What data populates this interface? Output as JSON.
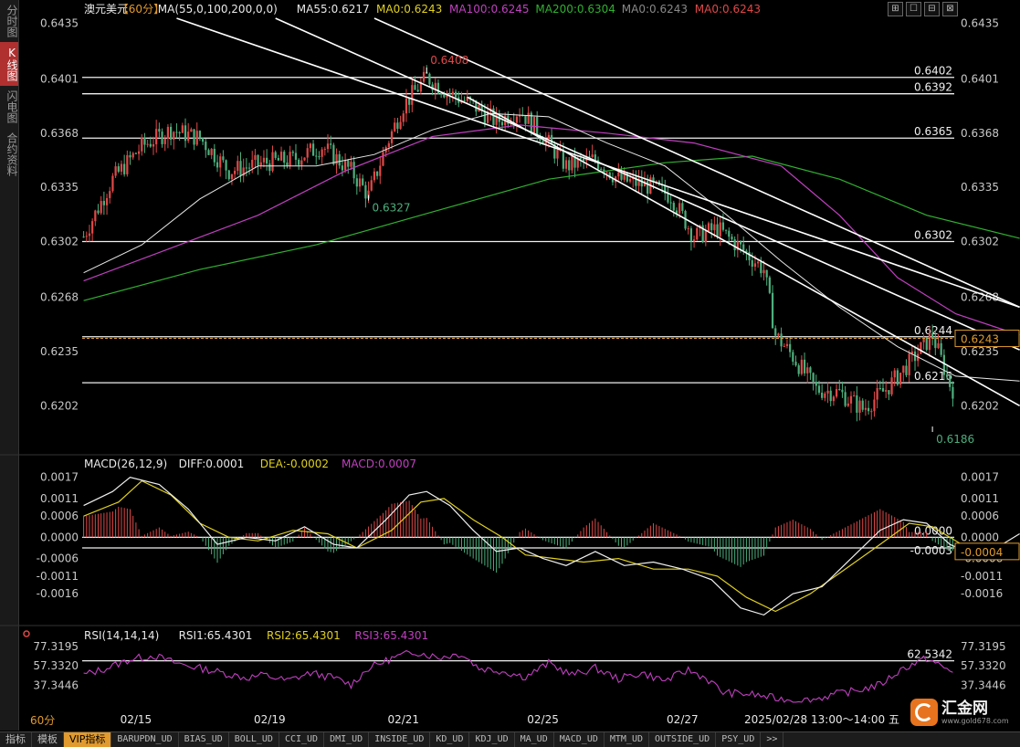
{
  "window_controls": [
    "⊞",
    "☐",
    "⊟",
    "⊠"
  ],
  "side_tabs": [
    {
      "label": "分时图",
      "active": false
    },
    {
      "label": "K线图",
      "active": true
    },
    {
      "label": "闪电图",
      "active": false
    },
    {
      "label": "合约资料",
      "active": false
    }
  ],
  "period_label": "60分",
  "logo": {
    "text": "汇金网",
    "url": "www.gold678.com"
  },
  "bottom_tabs": [
    {
      "label": "指标",
      "active": false,
      "big": true
    },
    {
      "label": "模板",
      "active": false,
      "big": true
    },
    {
      "label": "VIP指标",
      "active": true,
      "big": true
    },
    {
      "label": "BARUPDN_UD",
      "active": false
    },
    {
      "label": "BIAS_UD",
      "active": false
    },
    {
      "label": "BOLL_UD",
      "active": false
    },
    {
      "label": "CCI_UD",
      "active": false
    },
    {
      "label": "DMI_UD",
      "active": false
    },
    {
      "label": "INSIDE_UD",
      "active": false
    },
    {
      "label": "KD_UD",
      "active": false
    },
    {
      "label": "KDJ_UD",
      "active": false
    },
    {
      "label": "MA_UD",
      "active": false
    },
    {
      "label": "MACD_UD",
      "active": false
    },
    {
      "label": "MTM_UD",
      "active": false
    },
    {
      "label": "OUTSIDE_UD",
      "active": false
    },
    {
      "label": "PSY_UD",
      "active": false
    },
    {
      "label": ">>",
      "active": false
    }
  ],
  "colors": {
    "bg": "#000000",
    "up": "#e04848",
    "down": "#4caf7d",
    "ma_white": "#e8e8e8",
    "ma_magenta": "#c040c0",
    "ma_green": "#30b030",
    "yellow": "#e0d020",
    "grid_text": "#c8c8c8",
    "orange": "#e09a2d"
  },
  "chart_data": [
    {
      "type": "candlestick",
      "title_parts": [
        {
          "text": "澳元美元",
          "color": "#e8e8e8"
        },
        {
          "text": "【60分】",
          "color": "#e09a2d"
        },
        {
          "text": "MA(55,0,100,200,0,0)",
          "color": "#e8e8e8"
        },
        {
          "text": "MA55:0.6217",
          "color": "#e8e8e8"
        },
        {
          "text": "MA0:0.6243",
          "color": "#e0d020"
        },
        {
          "text": "MA100:0.6245",
          "color": "#c040c0"
        },
        {
          "text": "MA200:0.6304",
          "color": "#30b030"
        },
        {
          "text": "MA0:0.6243",
          "color": "#888888"
        },
        {
          "text": "MA0:0.6243",
          "color": "#e04848"
        }
      ],
      "ylim": [
        0.6171,
        0.6438
      ],
      "yticks": [
        "0.6435",
        "0.6401",
        "0.6368",
        "0.6335",
        "0.6302",
        "0.6268",
        "0.6235",
        "0.6202"
      ],
      "xticks": [
        {
          "label": "02/15",
          "index": 18
        },
        {
          "label": "02/19",
          "index": 64
        },
        {
          "label": "02/21",
          "index": 110
        },
        {
          "label": "02/25",
          "index": 158
        },
        {
          "label": "02/27",
          "index": 206
        }
      ],
      "time_label": "2025/02/28 13:00～14:00 五",
      "current_price": "0.6243",
      "horizontal_levels": [
        {
          "value": 0.6402,
          "label": "0.6402"
        },
        {
          "value": 0.6392,
          "label": "0.6392"
        },
        {
          "value": 0.6365,
          "label": "0.6365"
        },
        {
          "value": 0.6302,
          "label": "0.6302"
        },
        {
          "value": 0.6244,
          "label": "0.6244"
        },
        {
          "value": 0.6216,
          "label": "0.6216"
        }
      ],
      "annotations": [
        {
          "text": "0.6408",
          "index": 118,
          "value": 0.6408,
          "color": "#e04848"
        },
        {
          "text": "0.6327",
          "index": 98,
          "value": 0.6327,
          "color": "#4caf7d"
        },
        {
          "text": "0.6186",
          "index": 292,
          "value": 0.6186,
          "color": "#4caf7d"
        }
      ],
      "n_bars": 300,
      "anchors": [
        [
          0,
          0.6305
        ],
        [
          10,
          0.634
        ],
        [
          20,
          0.636
        ],
        [
          30,
          0.637
        ],
        [
          40,
          0.6365
        ],
        [
          50,
          0.6345
        ],
        [
          62,
          0.635
        ],
        [
          72,
          0.6352
        ],
        [
          82,
          0.636
        ],
        [
          92,
          0.6345
        ],
        [
          98,
          0.633
        ],
        [
          104,
          0.636
        ],
        [
          110,
          0.6385
        ],
        [
          118,
          0.6402
        ],
        [
          126,
          0.6392
        ],
        [
          134,
          0.6385
        ],
        [
          142,
          0.6375
        ],
        [
          150,
          0.6382
        ],
        [
          158,
          0.6366
        ],
        [
          166,
          0.6348
        ],
        [
          176,
          0.6352
        ],
        [
          184,
          0.634
        ],
        [
          194,
          0.6336
        ],
        [
          202,
          0.633
        ],
        [
          210,
          0.6305
        ],
        [
          218,
          0.631
        ],
        [
          226,
          0.6298
        ],
        [
          234,
          0.6285
        ],
        [
          238,
          0.6245
        ],
        [
          244,
          0.6232
        ],
        [
          252,
          0.6212
        ],
        [
          260,
          0.621
        ],
        [
          268,
          0.62
        ],
        [
          276,
          0.6212
        ],
        [
          284,
          0.6228
        ],
        [
          292,
          0.6245
        ],
        [
          298,
          0.6215
        ],
        [
          304,
          0.6198
        ],
        [
          310,
          0.6188
        ],
        [
          318,
          0.621
        ],
        [
          322,
          0.6243
        ]
      ],
      "ma_white": [
        [
          0,
          0.6283
        ],
        [
          20,
          0.63
        ],
        [
          40,
          0.6328
        ],
        [
          60,
          0.6348
        ],
        [
          80,
          0.6348
        ],
        [
          100,
          0.6355
        ],
        [
          120,
          0.637
        ],
        [
          140,
          0.638
        ],
        [
          160,
          0.6378
        ],
        [
          180,
          0.6362
        ],
        [
          200,
          0.6348
        ],
        [
          220,
          0.632
        ],
        [
          240,
          0.629
        ],
        [
          260,
          0.6262
        ],
        [
          280,
          0.6238
        ],
        [
          300,
          0.622
        ],
        [
          322,
          0.6217
        ]
      ],
      "ma_magenta": [
        [
          0,
          0.6278
        ],
        [
          30,
          0.6298
        ],
        [
          60,
          0.6318
        ],
        [
          90,
          0.6345
        ],
        [
          120,
          0.6366
        ],
        [
          150,
          0.6373
        ],
        [
          180,
          0.6368
        ],
        [
          210,
          0.6362
        ],
        [
          240,
          0.6348
        ],
        [
          260,
          0.6318
        ],
        [
          280,
          0.628
        ],
        [
          300,
          0.6258
        ],
        [
          322,
          0.6245
        ]
      ],
      "ma_green": [
        [
          0,
          0.6266
        ],
        [
          40,
          0.6285
        ],
        [
          80,
          0.63
        ],
        [
          120,
          0.632
        ],
        [
          160,
          0.634
        ],
        [
          200,
          0.635
        ],
        [
          230,
          0.6354
        ],
        [
          260,
          0.634
        ],
        [
          290,
          0.6318
        ],
        [
          322,
          0.6304
        ]
      ],
      "channels": [
        [
          [
            32,
            0.6438
          ],
          [
            322,
            0.6262
          ]
        ],
        [
          [
            66,
            0.6438
          ],
          [
            322,
            0.6236
          ]
        ],
        [
          [
            100,
            0.6438
          ],
          [
            322,
            0.6262
          ]
        ],
        [
          [
            132,
            0.639
          ],
          [
            322,
            0.6202
          ]
        ]
      ]
    },
    {
      "type": "macd",
      "title_parts": [
        {
          "text": "MACD(26,12,9)",
          "color": "#e8e8e8"
        },
        {
          "text": "DIFF:0.0001",
          "color": "#e8e8e8"
        },
        {
          "text": "DEA:-0.0002",
          "color": "#e0d020"
        },
        {
          "text": "MACD:0.0007",
          "color": "#c040c0"
        }
      ],
      "ylim": [
        -0.0025,
        0.0019
      ],
      "yticks": [
        "0.0017",
        "0.0011",
        "0.0006",
        "0.0000",
        "-0.0006",
        "-0.0011",
        "-0.0016"
      ],
      "levels": [
        {
          "value": 0.0,
          "label": "0.0000"
        },
        {
          "value": -0.0003,
          "label": "-0.0003"
        }
      ],
      "current_value": "-0.0004",
      "diff": [
        [
          0,
          0.0009
        ],
        [
          10,
          0.0013
        ],
        [
          16,
          0.0017
        ],
        [
          26,
          0.0015
        ],
        [
          36,
          0.0008
        ],
        [
          46,
          -0.0002
        ],
        [
          56,
          0.0
        ],
        [
          66,
          -0.0001
        ],
        [
          76,
          0.0003
        ],
        [
          86,
          -0.0002
        ],
        [
          94,
          -0.0003
        ],
        [
          104,
          0.0005
        ],
        [
          112,
          0.0012
        ],
        [
          118,
          0.0013
        ],
        [
          126,
          0.0009
        ],
        [
          134,
          0.0002
        ],
        [
          142,
          -0.0004
        ],
        [
          150,
          -0.0003
        ],
        [
          158,
          -0.0006
        ],
        [
          166,
          -0.0008
        ],
        [
          176,
          -0.0004
        ],
        [
          186,
          -0.0008
        ],
        [
          196,
          -0.0007
        ],
        [
          206,
          -0.0009
        ],
        [
          216,
          -0.0012
        ],
        [
          226,
          -0.002
        ],
        [
          234,
          -0.0022
        ],
        [
          244,
          -0.0016
        ],
        [
          254,
          -0.0014
        ],
        [
          264,
          -0.0006
        ],
        [
          274,
          0.0002
        ],
        [
          282,
          0.0005
        ],
        [
          290,
          0.0004
        ],
        [
          298,
          -0.0002
        ],
        [
          306,
          -0.0005
        ],
        [
          314,
          -0.0003
        ],
        [
          322,
          0.0001
        ]
      ],
      "dea": [
        [
          0,
          0.0006
        ],
        [
          12,
          0.001
        ],
        [
          20,
          0.0016
        ],
        [
          30,
          0.0012
        ],
        [
          40,
          0.0004
        ],
        [
          50,
          0.0
        ],
        [
          60,
          -0.0001
        ],
        [
          72,
          0.0002
        ],
        [
          84,
          0.0001
        ],
        [
          94,
          -0.0003
        ],
        [
          106,
          0.0002
        ],
        [
          116,
          0.001
        ],
        [
          124,
          0.0011
        ],
        [
          134,
          0.0005
        ],
        [
          144,
          0.0
        ],
        [
          152,
          -0.0005
        ],
        [
          162,
          -0.0006
        ],
        [
          172,
          -0.0007
        ],
        [
          184,
          -0.0006
        ],
        [
          196,
          -0.0009
        ],
        [
          208,
          -0.0009
        ],
        [
          218,
          -0.0011
        ],
        [
          228,
          -0.0017
        ],
        [
          238,
          -0.0021
        ],
        [
          250,
          -0.0016
        ],
        [
          262,
          -0.0009
        ],
        [
          274,
          -0.0002
        ],
        [
          284,
          0.0004
        ],
        [
          292,
          0.0003
        ],
        [
          302,
          -0.0002
        ],
        [
          312,
          -0.0004
        ],
        [
          322,
          -0.0002
        ]
      ]
    },
    {
      "type": "rsi",
      "title_parts": [
        {
          "text": "RSI(14,14,14)",
          "color": "#e8e8e8"
        },
        {
          "text": "RSI1:65.4301",
          "color": "#e8e8e8"
        },
        {
          "text": "RSI2:65.4301",
          "color": "#e0d020"
        },
        {
          "text": "RSI3:65.4301",
          "color": "#c040c0"
        }
      ],
      "ylim": [
        19,
        80
      ],
      "yticks": [
        "77.3195",
        "57.3320",
        "37.3446"
      ],
      "levels": [
        {
          "value": 62.5342,
          "label": "62.5342"
        }
      ],
      "rsi": [
        [
          0,
          48
        ],
        [
          8,
          55
        ],
        [
          16,
          64
        ],
        [
          24,
          68
        ],
        [
          32,
          60
        ],
        [
          40,
          55
        ],
        [
          48,
          50
        ],
        [
          56,
          45
        ],
        [
          62,
          48
        ],
        [
          70,
          42
        ],
        [
          78,
          50
        ],
        [
          86,
          45
        ],
        [
          92,
          38
        ],
        [
          98,
          55
        ],
        [
          106,
          65
        ],
        [
          114,
          72
        ],
        [
          122,
          66
        ],
        [
          130,
          70
        ],
        [
          136,
          55
        ],
        [
          144,
          52
        ],
        [
          152,
          46
        ],
        [
          160,
          60
        ],
        [
          168,
          48
        ],
        [
          176,
          55
        ],
        [
          184,
          44
        ],
        [
          192,
          50
        ],
        [
          200,
          42
        ],
        [
          208,
          53
        ],
        [
          214,
          45
        ],
        [
          220,
          30
        ],
        [
          230,
          28
        ],
        [
          240,
          23
        ],
        [
          250,
          22
        ],
        [
          258,
          28
        ],
        [
          266,
          32
        ],
        [
          274,
          38
        ],
        [
          282,
          55
        ],
        [
          290,
          65
        ],
        [
          298,
          52
        ],
        [
          306,
          48
        ],
        [
          312,
          60
        ],
        [
          318,
          53
        ],
        [
          322,
          66
        ]
      ]
    }
  ]
}
